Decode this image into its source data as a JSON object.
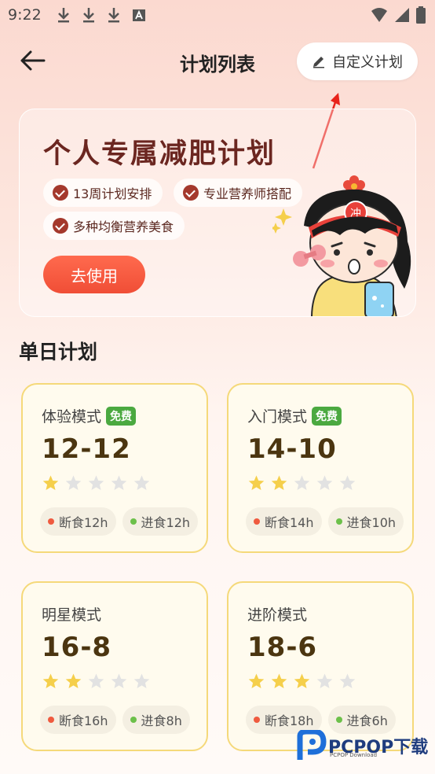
{
  "status_bar": {
    "time": "9:22"
  },
  "header": {
    "title": "计划列表",
    "custom_plan_label": "自定义计划"
  },
  "banner": {
    "title": "个人专属减肥计划",
    "features": [
      "13周计划安排",
      "专业营养师搭配",
      "多种均衡营养美食"
    ],
    "cta_label": "去使用",
    "mascot_badge": "冲"
  },
  "section": {
    "title": "单日计划"
  },
  "plans": [
    {
      "name": "体验模式",
      "badge": "免费",
      "ratio": "12-12",
      "stars": 1,
      "fast": "断食12h",
      "eat": "进食12h"
    },
    {
      "name": "入门模式",
      "badge": "免费",
      "ratio": "14-10",
      "stars": 2,
      "fast": "断食14h",
      "eat": "进食10h"
    },
    {
      "name": "明星模式",
      "badge": "",
      "ratio": "16-8",
      "stars": 2,
      "fast": "断食16h",
      "eat": "进食8h"
    },
    {
      "name": "进阶模式",
      "badge": "",
      "ratio": "18-6",
      "stars": 3,
      "fast": "断食18h",
      "eat": "进食6h"
    }
  ],
  "watermark": {
    "brand": "PCPOP下载",
    "sub": "PCPOP Download"
  },
  "colors": {
    "star_on": "#f5cf4b",
    "star_off": "#e2e2e2",
    "fast_dot": "#ef5a3f",
    "eat_dot": "#6cc04a",
    "accent": "#f04e36"
  }
}
